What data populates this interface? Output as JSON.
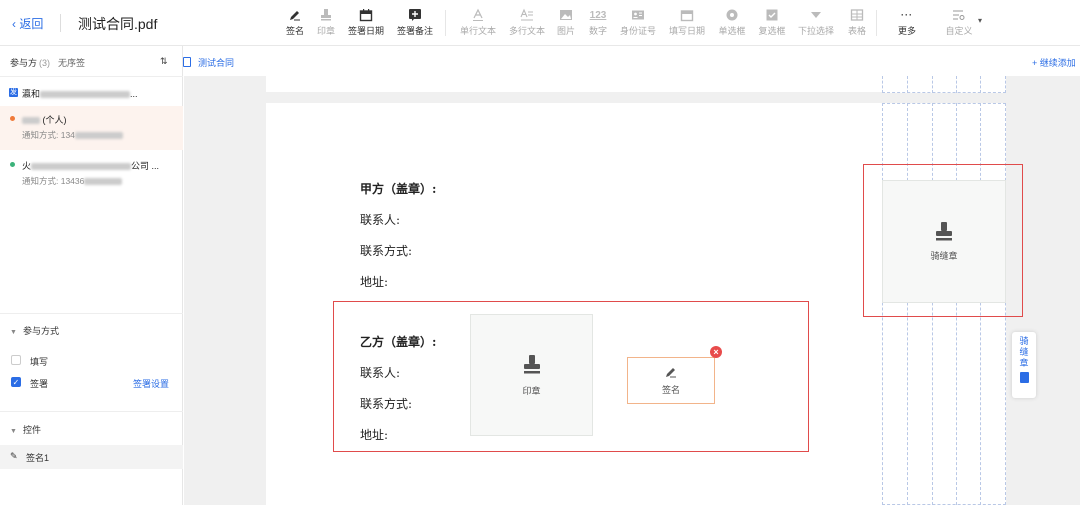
{
  "header": {
    "back_label": "返回",
    "doc_title": "测试合同.pdf"
  },
  "toolbar": {
    "items": [
      {
        "label": "签名",
        "icon": "pen-icon",
        "enabled": true
      },
      {
        "label": "印章",
        "icon": "stamp-icon",
        "enabled": false
      },
      {
        "label": "签署日期",
        "icon": "calendar-icon",
        "enabled": true
      },
      {
        "label": "签署备注",
        "icon": "note-plus-icon",
        "enabled": true
      },
      {
        "label": "单行文本",
        "icon": "text-icon",
        "enabled": false
      },
      {
        "label": "多行文本",
        "icon": "multiline-text-icon",
        "enabled": false
      },
      {
        "label": "图片",
        "icon": "image-icon",
        "enabled": false
      },
      {
        "label": "数字",
        "icon": "number-icon",
        "enabled": false
      },
      {
        "label": "身份证号",
        "icon": "id-card-icon",
        "enabled": false
      },
      {
        "label": "填写日期",
        "icon": "calendar-icon",
        "enabled": false
      },
      {
        "label": "单选框",
        "icon": "radio-icon",
        "enabled": false
      },
      {
        "label": "复选框",
        "icon": "checkbox-icon",
        "enabled": false
      },
      {
        "label": "下拉选择",
        "icon": "dropdown-icon",
        "enabled": false
      },
      {
        "label": "表格",
        "icon": "table-icon",
        "enabled": false
      },
      {
        "label": "更多",
        "icon": "more-icon",
        "enabled": true
      },
      {
        "label": "自定义",
        "icon": "custom-icon",
        "enabled": false
      }
    ],
    "number_glyph": "123"
  },
  "subbar": {
    "doc_link": "测试合同",
    "continue_add": "+ 继续添加"
  },
  "sidebar": {
    "participants_label": "参与方",
    "participants_count": "(3)",
    "no_order": "无序签",
    "parties": [
      {
        "badge": "发",
        "name_prefix": "瀛和",
        "name_suffix": "...",
        "contact": ""
      },
      {
        "name_prefix": "",
        "name_suffix": "(个人)",
        "contact": "通知方式: 134"
      },
      {
        "name_prefix": "火",
        "name_suffix": "公司 ...",
        "contact": "通知方式: 13436"
      }
    ],
    "participation_title": "参与方式",
    "fill_label": "填写",
    "sign_label": "签署",
    "sign_settings": "签署设置",
    "controls_title": "控件",
    "control_item": "签名1"
  },
  "document": {
    "party_a": "甲方（盖章）:",
    "party_b": "乙方（盖章）:",
    "contact_person": "联系人:",
    "contact_method": "联系方式:",
    "address": "地址:",
    "seal_label": "印章",
    "sign_label": "签名",
    "seam_seal_label": "骑缝章",
    "side_tab_label": "骑缝章"
  },
  "colors": {
    "accent": "#2b6de5",
    "highlight_border": "#e04b4b",
    "selected_party_bg": "#fdf3ee",
    "active_dot": "#f07a3a",
    "green_dot": "#3bb27a"
  }
}
